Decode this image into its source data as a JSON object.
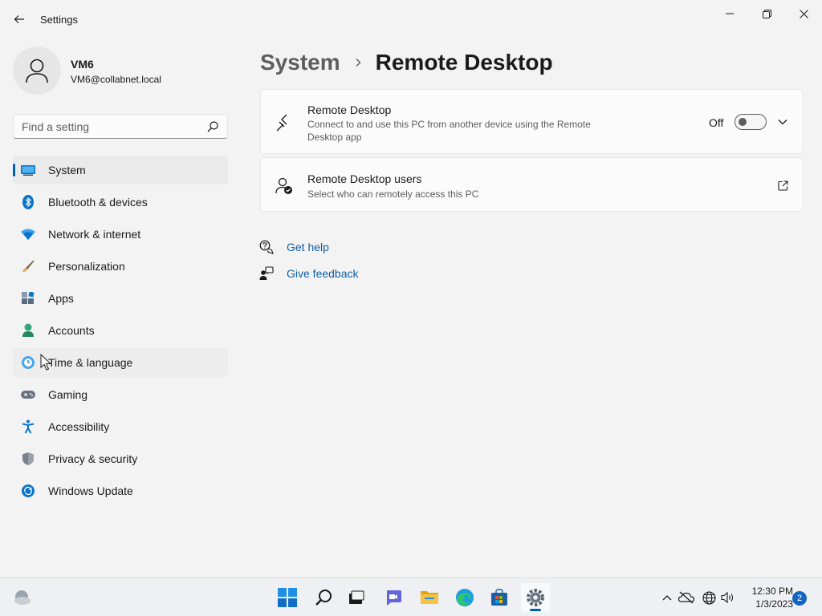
{
  "window": {
    "title": "Settings"
  },
  "profile": {
    "name": "VM6",
    "email": "VM6@collabnet.local"
  },
  "search": {
    "placeholder": "Find a setting"
  },
  "sidebar": {
    "items": [
      {
        "label": "System",
        "icon": "system-display-icon",
        "selected": true
      },
      {
        "label": "Bluetooth & devices",
        "icon": "bluetooth-icon"
      },
      {
        "label": "Network & internet",
        "icon": "wifi-icon"
      },
      {
        "label": "Personalization",
        "icon": "brush-icon"
      },
      {
        "label": "Apps",
        "icon": "apps-icon"
      },
      {
        "label": "Accounts",
        "icon": "person-icon"
      },
      {
        "label": "Time & language",
        "icon": "globe-clock-icon",
        "hovered": true
      },
      {
        "label": "Gaming",
        "icon": "gamepad-icon"
      },
      {
        "label": "Accessibility",
        "icon": "accessibility-icon"
      },
      {
        "label": "Privacy & security",
        "icon": "shield-icon"
      },
      {
        "label": "Windows Update",
        "icon": "update-icon"
      }
    ]
  },
  "breadcrumb": {
    "parent": "System",
    "current": "Remote Desktop"
  },
  "remote_desktop": {
    "title": "Remote Desktop",
    "description": "Connect to and use this PC from another device using the Remote Desktop app",
    "toggle_state": "Off"
  },
  "remote_users": {
    "title": "Remote Desktop users",
    "description": "Select who can remotely access this PC"
  },
  "help": {
    "get_help": "Get help",
    "give_feedback": "Give feedback"
  },
  "taskbar": {
    "time": "12:30 PM",
    "date": "1/3/2023",
    "notification_count": "2"
  },
  "colors": {
    "accent": "#005fb8",
    "link": "#0e5ea8",
    "background": "#f3f3f3",
    "card": "#fbfbfb"
  }
}
